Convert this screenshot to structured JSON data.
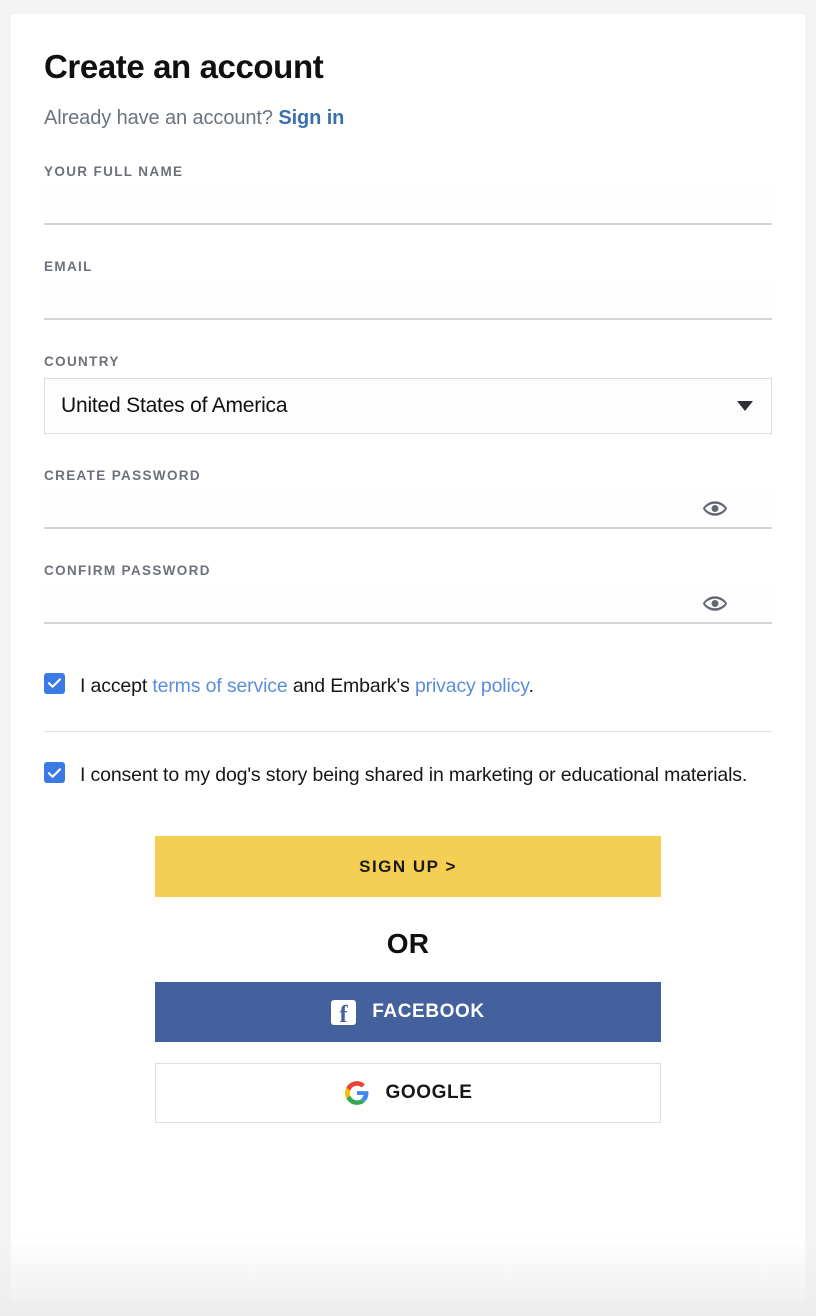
{
  "header": {
    "title": "Create an account",
    "subtitle_prefix": "Already have an account?",
    "signin_link": "Sign in"
  },
  "fields": {
    "full_name": {
      "label": "YOUR FULL NAME",
      "value": "",
      "placeholder": ""
    },
    "email": {
      "label": "EMAIL",
      "value": "",
      "placeholder": ""
    },
    "country": {
      "label": "COUNTRY",
      "value": "United States of America"
    },
    "create_password": {
      "label": "CREATE PASSWORD",
      "value": "",
      "placeholder": ""
    },
    "confirm_password": {
      "label": "CONFIRM PASSWORD",
      "value": "",
      "placeholder": ""
    }
  },
  "consents": {
    "terms": {
      "checked": true,
      "text_1": "I accept ",
      "link_terms": "terms of service",
      "text_2": " and Embark's ",
      "link_privacy": "privacy policy",
      "text_3": "."
    },
    "marketing": {
      "checked": true,
      "text": "I consent to my dog's story being shared in marketing or educational materials."
    }
  },
  "actions": {
    "signup_label": "SIGN UP >",
    "or_label": "OR",
    "facebook_label": "FACEBOOK",
    "google_label": "GOOGLE"
  },
  "icons": {
    "eye": "eye-icon",
    "chevron": "chevron-down-icon",
    "check": "check-icon",
    "facebook": "facebook-icon",
    "google": "google-icon"
  },
  "colors": {
    "accent_yellow": "#f5cf54",
    "facebook_blue": "#45619d",
    "checkbox_blue": "#3b7ae4",
    "link_blue": "#5b8dd9",
    "signin_blue": "#3b6fb0",
    "label_gray": "#6d717a"
  }
}
